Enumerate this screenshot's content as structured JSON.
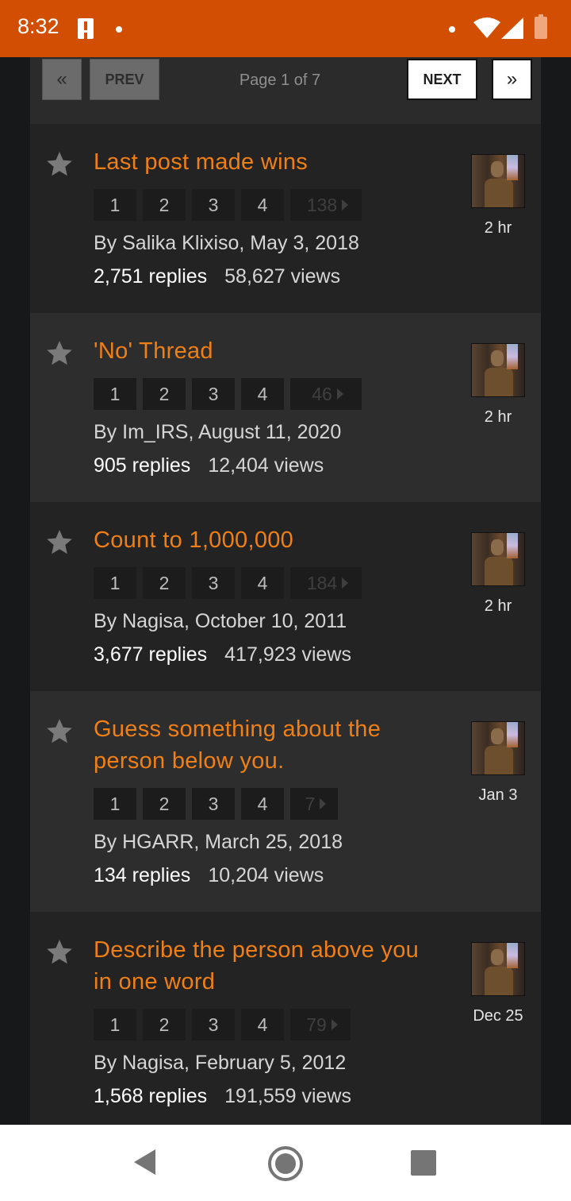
{
  "status_bar": {
    "time": "8:32"
  },
  "pager": {
    "first_icon": "«",
    "prev_label": "PREV",
    "page_info": "Page 1 of 7",
    "next_label": "NEXT",
    "last_icon": "»"
  },
  "topics": [
    {
      "title": "Last post made wins",
      "pages": [
        "1",
        "2",
        "3",
        "4"
      ],
      "last_page": "138",
      "author_line": "By Salika Klixiso, May 3, 2018",
      "replies": "2,751 replies",
      "views": "58,627 views",
      "time": "2 hr"
    },
    {
      "title": "'No' Thread",
      "pages": [
        "1",
        "2",
        "3",
        "4"
      ],
      "last_page": "46",
      "author_line": "By Im_IRS, August 11, 2020",
      "replies": "905 replies",
      "views": "12,404 views",
      "time": "2 hr"
    },
    {
      "title": "Count to 1,000,000",
      "pages": [
        "1",
        "2",
        "3",
        "4"
      ],
      "last_page": "184",
      "author_line": "By Nagisa, October 10, 2011",
      "replies": "3,677 replies",
      "views": "417,923 views",
      "time": "2 hr"
    },
    {
      "title": "Guess something about the person below you.",
      "pages": [
        "1",
        "2",
        "3",
        "4"
      ],
      "last_page": "7",
      "author_line": "By HGARR, March 25, 2018",
      "replies": "134 replies",
      "views": "10,204 views",
      "time": "Jan 3"
    },
    {
      "title": "Describe the person above you in one word",
      "pages": [
        "1",
        "2",
        "3",
        "4"
      ],
      "last_page": "79",
      "author_line": "By Nagisa, February 5, 2012",
      "replies": "1,568 replies",
      "views": "191,559 views",
      "time": "Dec 25"
    }
  ],
  "colors": {
    "accent": "#d24e03",
    "title": "#f07f15"
  }
}
